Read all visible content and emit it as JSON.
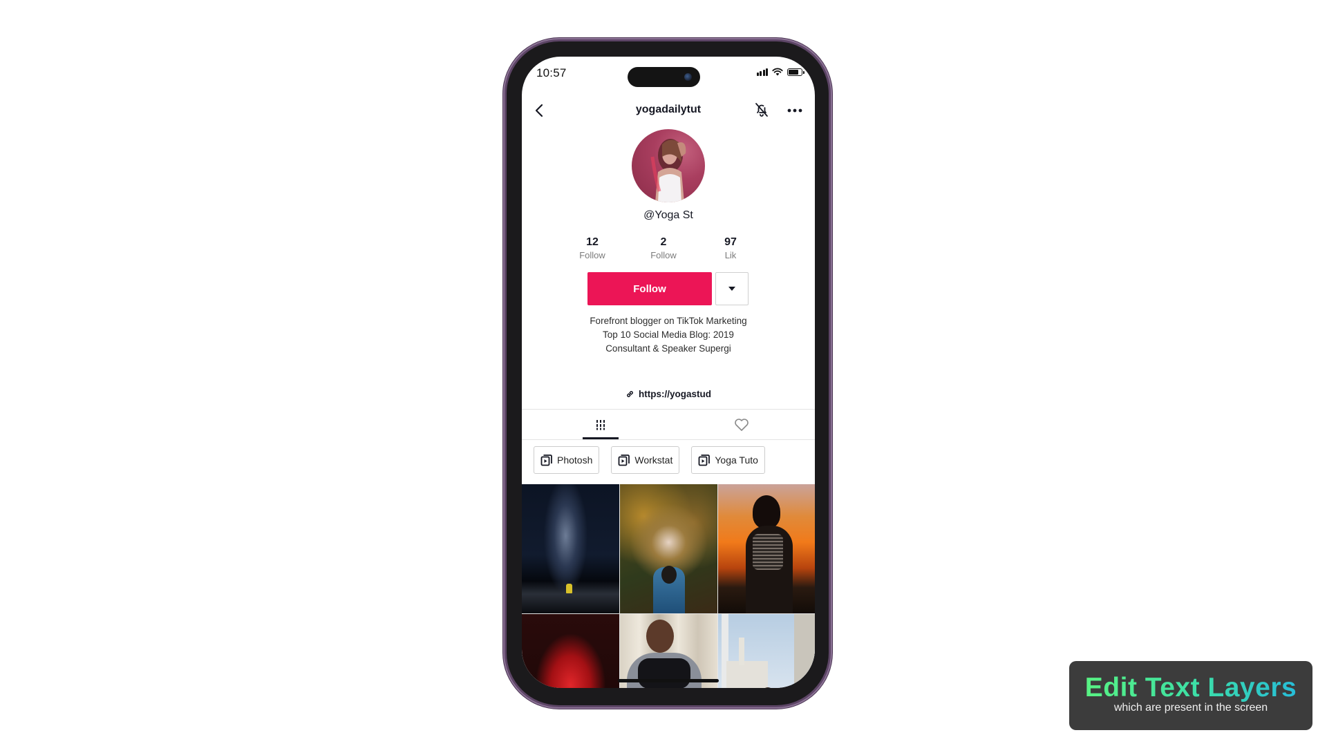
{
  "status_bar": {
    "time": "10:57",
    "icons": [
      "cellular-signal-icon",
      "wifi-icon",
      "battery-icon"
    ],
    "battery_level_percent": 80
  },
  "nav": {
    "back_icon": "chevron-left-icon",
    "title": "yogadailytut",
    "notification_icon": "bell-off-icon",
    "more_icon": "more-horizontal-icon"
  },
  "profile": {
    "avatar_alt": "profile photo",
    "username": "@Yoga St",
    "stats": [
      {
        "value": "12",
        "label": "Follow"
      },
      {
        "value": "2",
        "label": "Follow"
      },
      {
        "value": "97",
        "label": "Lik"
      }
    ],
    "follow_label": "Follow",
    "dropdown_icon": "caret-down-icon",
    "bio": [
      "Forefront blogger on TikTok Marketing",
      "Top 10 Social Media Blog: 2019",
      "Consultant & Speaker Supergi"
    ],
    "link_icon": "link-icon",
    "link": "https://yogastud"
  },
  "tabs": [
    {
      "name": "videos",
      "icon": "grid-bars-icon",
      "active": true
    },
    {
      "name": "liked",
      "icon": "heart-icon",
      "active": false
    }
  ],
  "playlists": [
    {
      "icon": "playlist-icon",
      "label": "Photosh"
    },
    {
      "icon": "playlist-icon",
      "label": "Workstat"
    },
    {
      "icon": "playlist-icon",
      "label": "Yoga Tuto"
    }
  ],
  "grid": [
    {
      "description": "person under milky way night sky"
    },
    {
      "description": "person reaching into autumn tree"
    },
    {
      "description": "woman silhouette at orange sunset"
    },
    {
      "description": "woman in red light"
    },
    {
      "description": "woman low angle with curtains"
    },
    {
      "description": "woman in front of building and sky"
    }
  ],
  "colors": {
    "accent": "#ec1556",
    "phone_frame": "#5d4566",
    "promo_bg": "#3c3c3c",
    "promo_gradient_start": "#5cf57e",
    "promo_gradient_end": "#23b8e0"
  },
  "promo": {
    "title": "Edit Text Layers",
    "subtitle": "which are present in the screen"
  }
}
